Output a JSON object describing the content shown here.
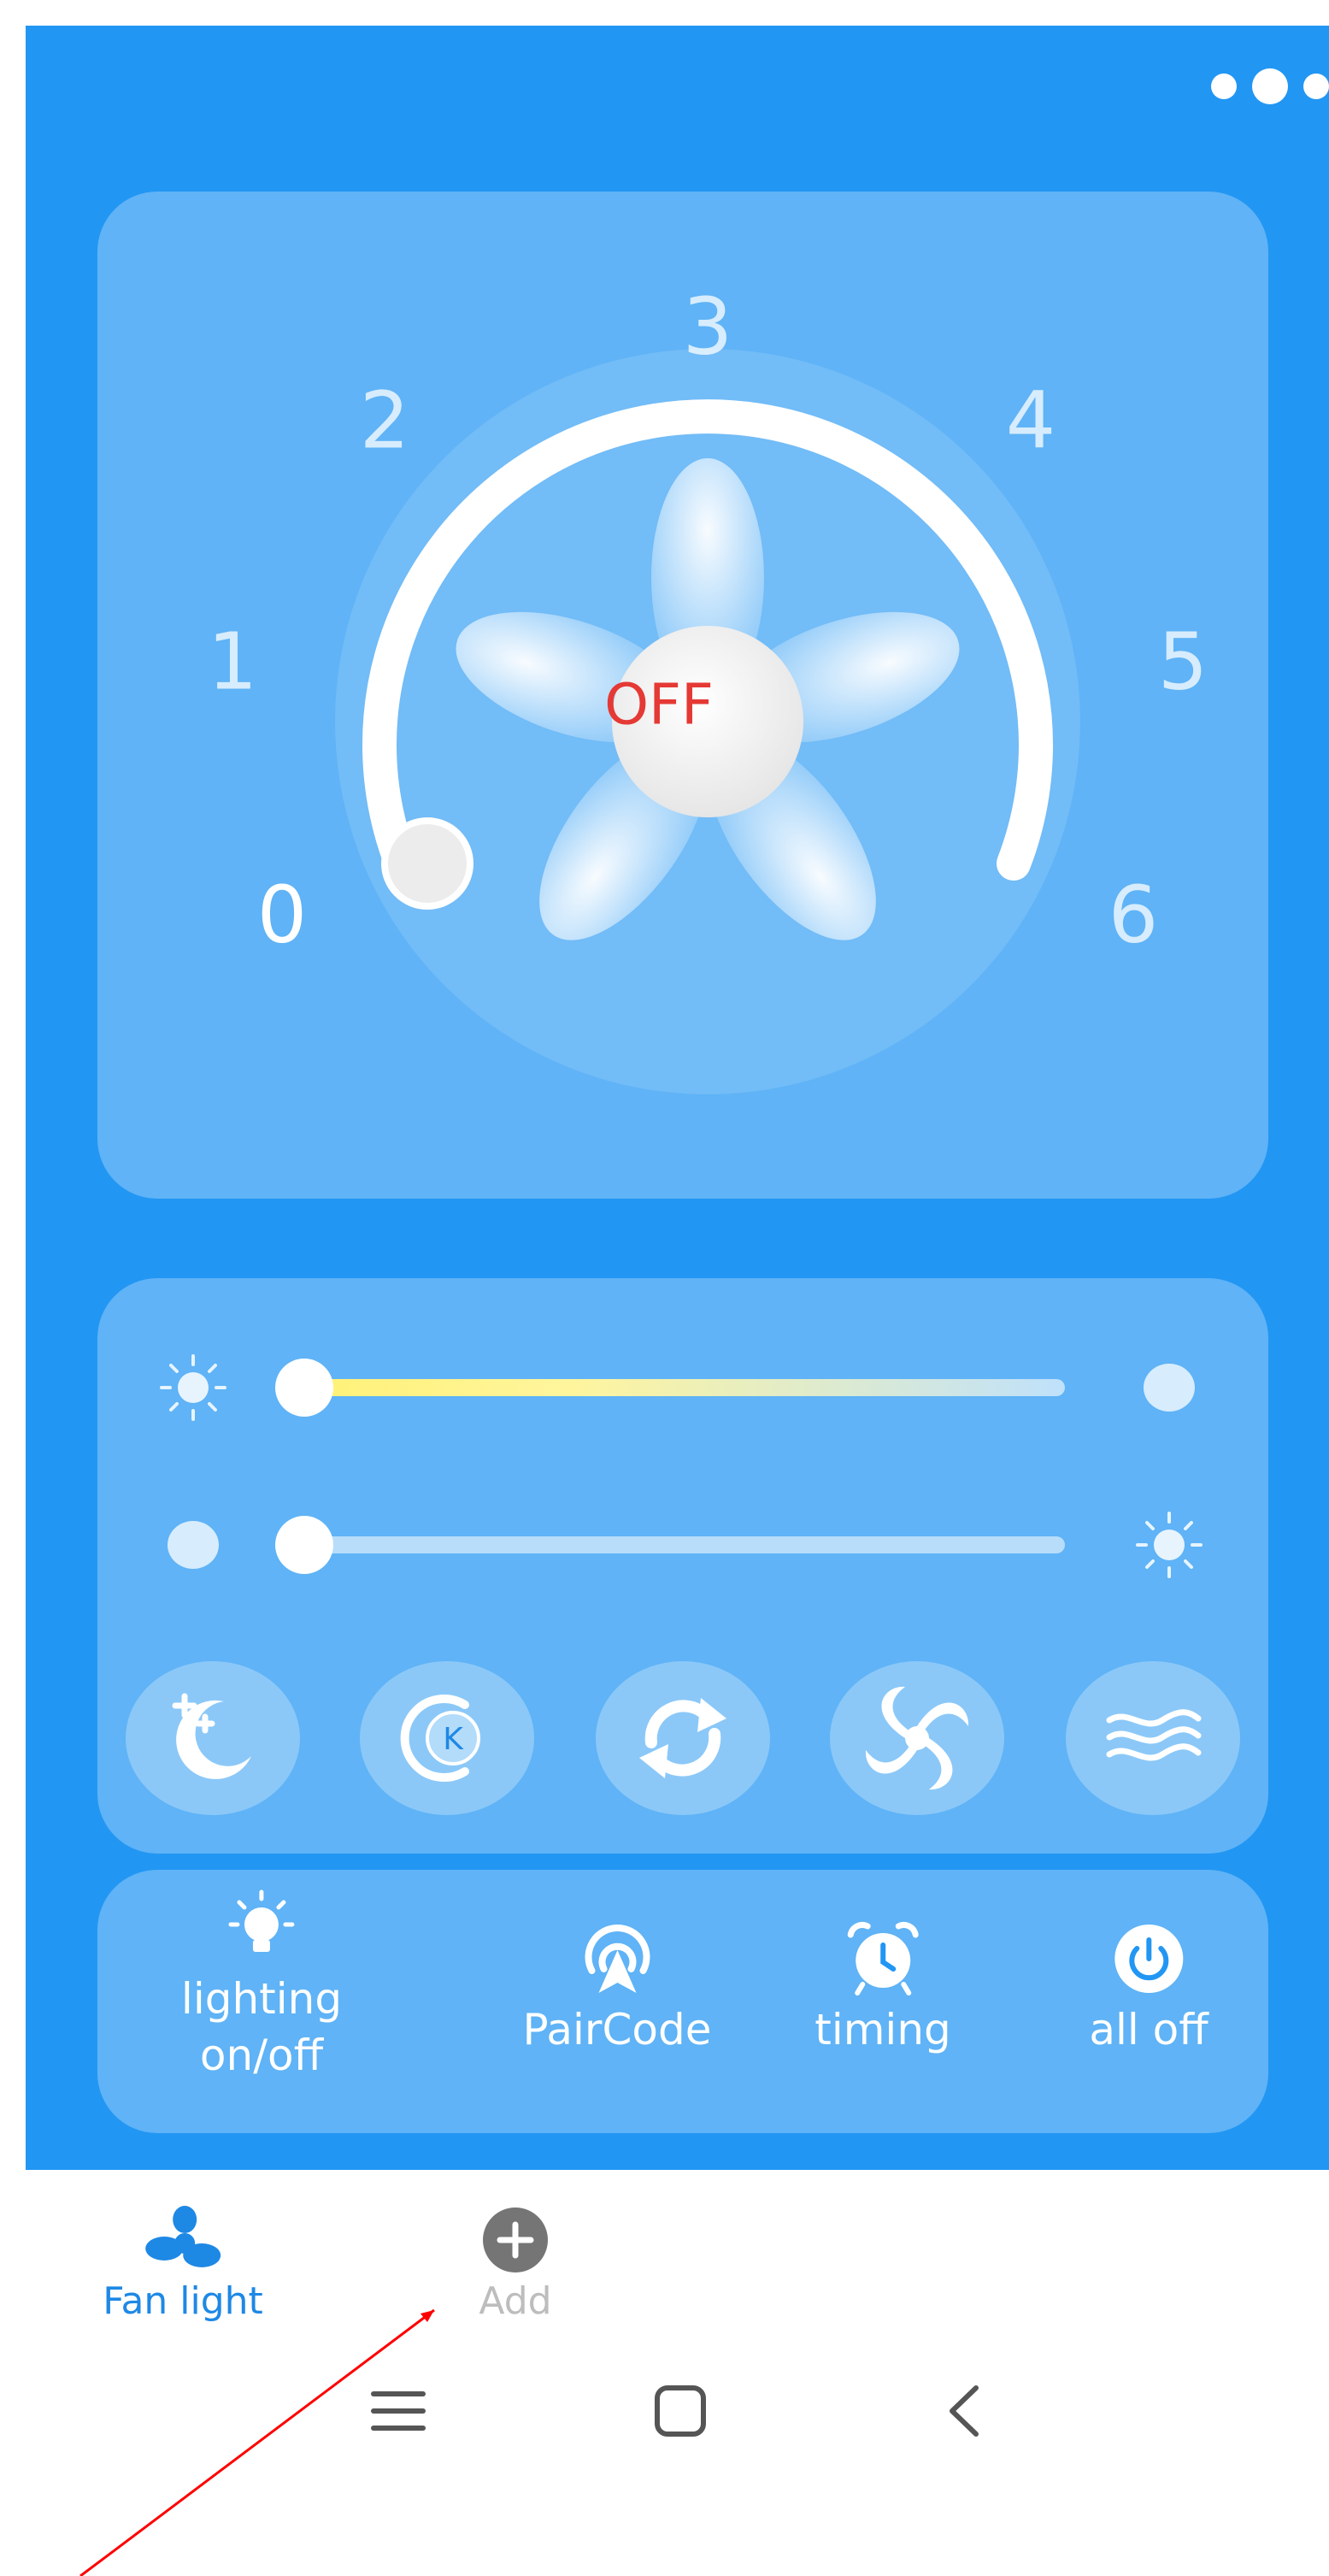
{
  "colors": {
    "background": "#2296f3",
    "card": "rgba(255,255,255,0.28)",
    "accent_text": "#1e88e5",
    "off_text": "#e53935",
    "brightness_fill": "#fff176"
  },
  "header": {
    "more_icon": "more-dots-icon"
  },
  "dial": {
    "scale": [
      "0",
      "1",
      "2",
      "3",
      "4",
      "5",
      "6"
    ],
    "center_label": "OFF",
    "current_speed": 0,
    "center_icon": "fan-blades-icon"
  },
  "sliders": {
    "brightness": {
      "level": 0,
      "left_icon": "sun-icon",
      "right_icon": "dot-icon"
    },
    "color_temp": {
      "level": 0,
      "left_icon": "dot-icon",
      "right_icon": "sun-icon"
    }
  },
  "modes": [
    {
      "icon": "night-mode-icon"
    },
    {
      "icon": "color-temperature-icon"
    },
    {
      "icon": "reverse-icon"
    },
    {
      "icon": "natural-wind-icon"
    },
    {
      "icon": "breeze-icon"
    }
  ],
  "functions": [
    {
      "label": "lighting\non/off",
      "icon": "bulb-icon"
    },
    {
      "label": "PairCode",
      "icon": "signal-icon"
    },
    {
      "label": "timing",
      "icon": "alarm-clock-icon"
    },
    {
      "label": "all off",
      "icon": "power-icon"
    }
  ],
  "tabs": [
    {
      "label": "Fan light",
      "icon": "fan-icon",
      "active": true
    },
    {
      "label": "Add",
      "icon": "add-icon",
      "active": false
    }
  ],
  "system_nav": [
    "menu-icon",
    "home-icon",
    "back-icon"
  ]
}
